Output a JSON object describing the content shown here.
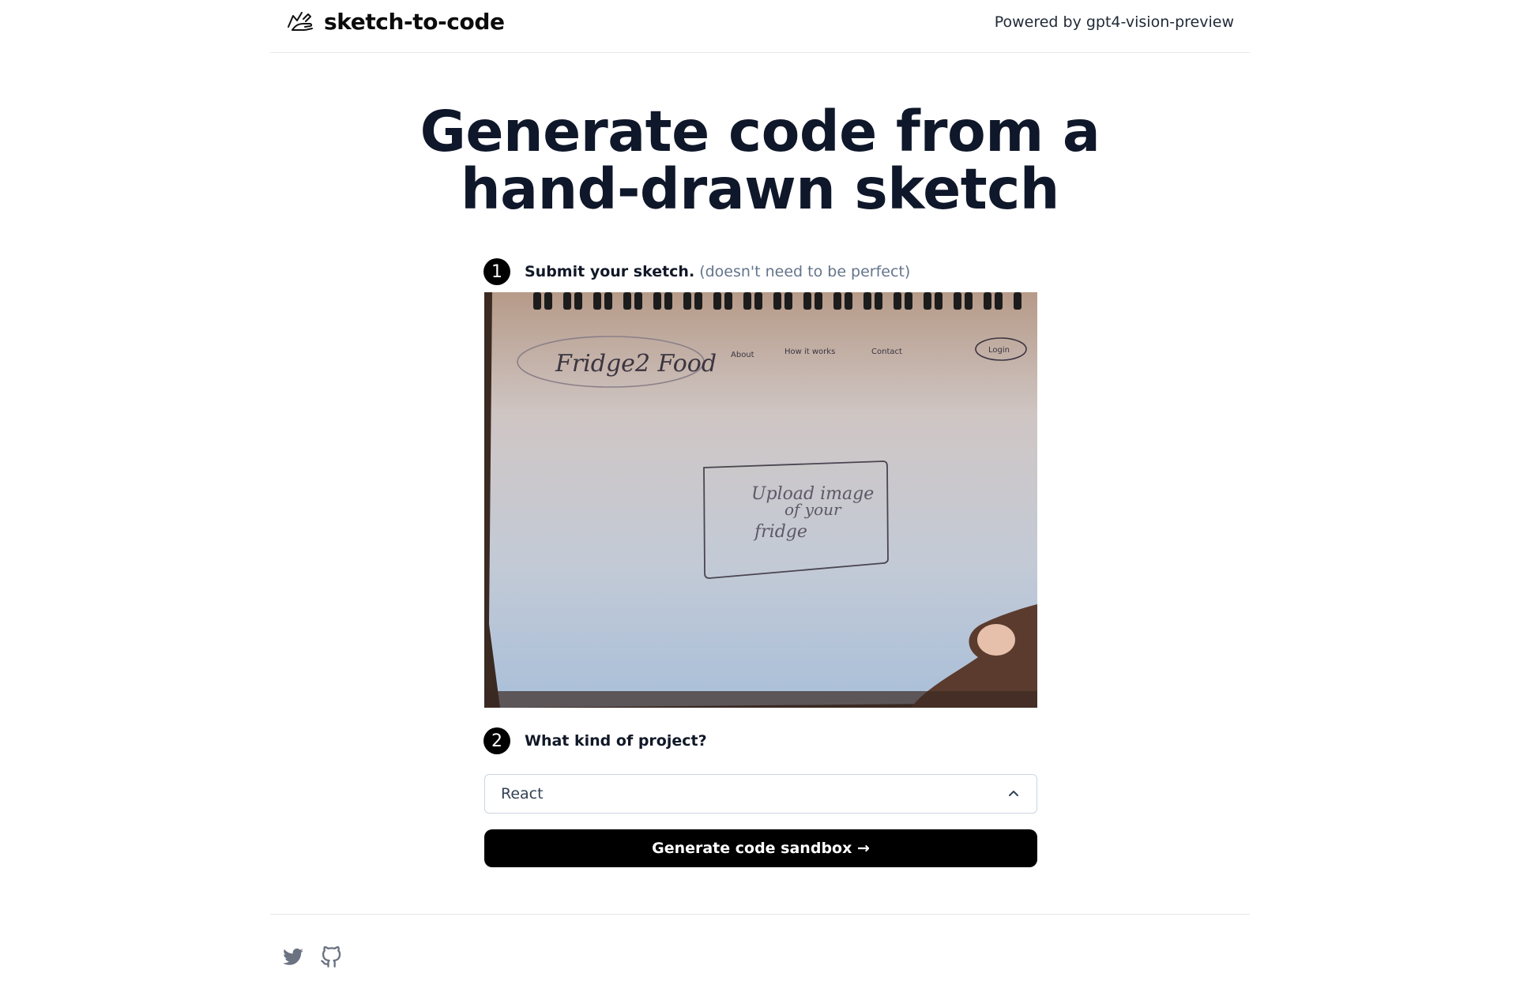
{
  "header": {
    "brand_name": "sketch-to-code",
    "powered_by": "Powered by gpt4-vision-preview"
  },
  "hero": {
    "title_line1": "Generate code from a",
    "title_line2": "hand-drawn sketch"
  },
  "steps": [
    {
      "number": "1",
      "label": "Submit your sketch.",
      "hint": "(doesn't need to be perfect)"
    },
    {
      "number": "2",
      "label": "What kind of project?"
    }
  ],
  "sketch": {
    "logo_text": "Fridge2 Food",
    "nav_items": [
      "About",
      "How it works",
      "Contact"
    ],
    "login": "Login",
    "box_text_lines": [
      "Upload image",
      "of your",
      "fridge"
    ]
  },
  "project_select": {
    "selected": "React"
  },
  "cta": {
    "label": "Generate code sandbox →"
  },
  "footer": {
    "icons": [
      "twitter-icon",
      "github-icon"
    ]
  },
  "colors": {
    "primary": "#000000",
    "muted_text": "#64748b",
    "border": "#e5e7eb",
    "footer_icon": "#6b7280"
  }
}
